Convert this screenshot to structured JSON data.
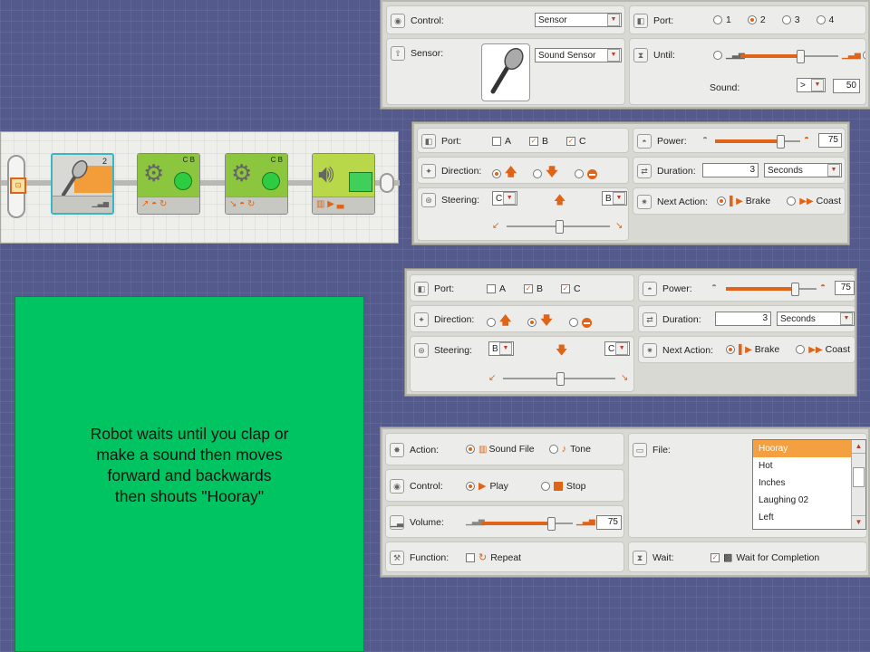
{
  "wait_panel": {
    "control_label": "Control:",
    "control_value": "Sensor",
    "sensor_label": "Sensor:",
    "sensor_value": "Sound Sensor",
    "port_label": "Port:",
    "ports": [
      "1",
      "2",
      "3",
      "4"
    ],
    "port_selected": "2",
    "until_label": "Until:",
    "until_level": 0.6,
    "sound_label": "Sound:",
    "comparison": ">",
    "sound_value": "50"
  },
  "sequence": {
    "wait_block_badge": "2",
    "move1_badge": "C B",
    "move2_badge": "C B"
  },
  "move1": {
    "port_label": "Port:",
    "ports": [
      "A",
      "B",
      "C"
    ],
    "ports_checked": [
      "B",
      "C"
    ],
    "direction_label": "Direction:",
    "direction_selected": "up",
    "steering_label": "Steering:",
    "steering_left": "C",
    "steering_right": "B",
    "steering_level": 0.5,
    "power_label": "Power:",
    "power_level": 0.75,
    "power_value": "75",
    "duration_label": "Duration:",
    "duration_value": "3",
    "duration_unit": "Seconds",
    "next_action_label": "Next Action:",
    "brake_label": "Brake",
    "coast_label": "Coast",
    "next_action_selected": "Brake"
  },
  "move2": {
    "port_label": "Port:",
    "ports": [
      "A",
      "B",
      "C"
    ],
    "ports_checked": [
      "B",
      "C"
    ],
    "direction_label": "Direction:",
    "direction_selected": "down",
    "steering_label": "Steering:",
    "steering_left": "B",
    "steering_right": "C",
    "steering_level": 0.5,
    "power_label": "Power:",
    "power_level": 0.75,
    "power_value": "75",
    "duration_label": "Duration:",
    "duration_value": "3",
    "duration_unit": "Seconds",
    "next_action_label": "Next Action:",
    "brake_label": "Brake",
    "coast_label": "Coast",
    "next_action_selected": "Brake"
  },
  "sound_panel": {
    "action_label": "Action:",
    "sound_file_label": "Sound File",
    "tone_label": "Tone",
    "action_selected": "Sound File",
    "control_label": "Control:",
    "play_label": "Play",
    "stop_label": "Stop",
    "control_selected": "Play",
    "volume_label": "Volume:",
    "volume_level": 0.75,
    "volume_value": "75",
    "function_label": "Function:",
    "repeat_label": "Repeat",
    "file_label": "File:",
    "files": [
      "Hooray",
      "Hot",
      "Inches",
      "Laughing 02",
      "Left"
    ],
    "file_selected": "Hooray",
    "wait_label": "Wait:",
    "wait_completion_label": "Wait for Completion"
  },
  "caption": {
    "line1": "Robot waits until you clap or",
    "line2": "make a sound then moves",
    "line3": "forward and backwards",
    "line4": "then shouts \"Hooray\""
  },
  "colors": {
    "accent": "#e06418",
    "caption_background": "#00c462",
    "slide_background": "#545a8c"
  }
}
